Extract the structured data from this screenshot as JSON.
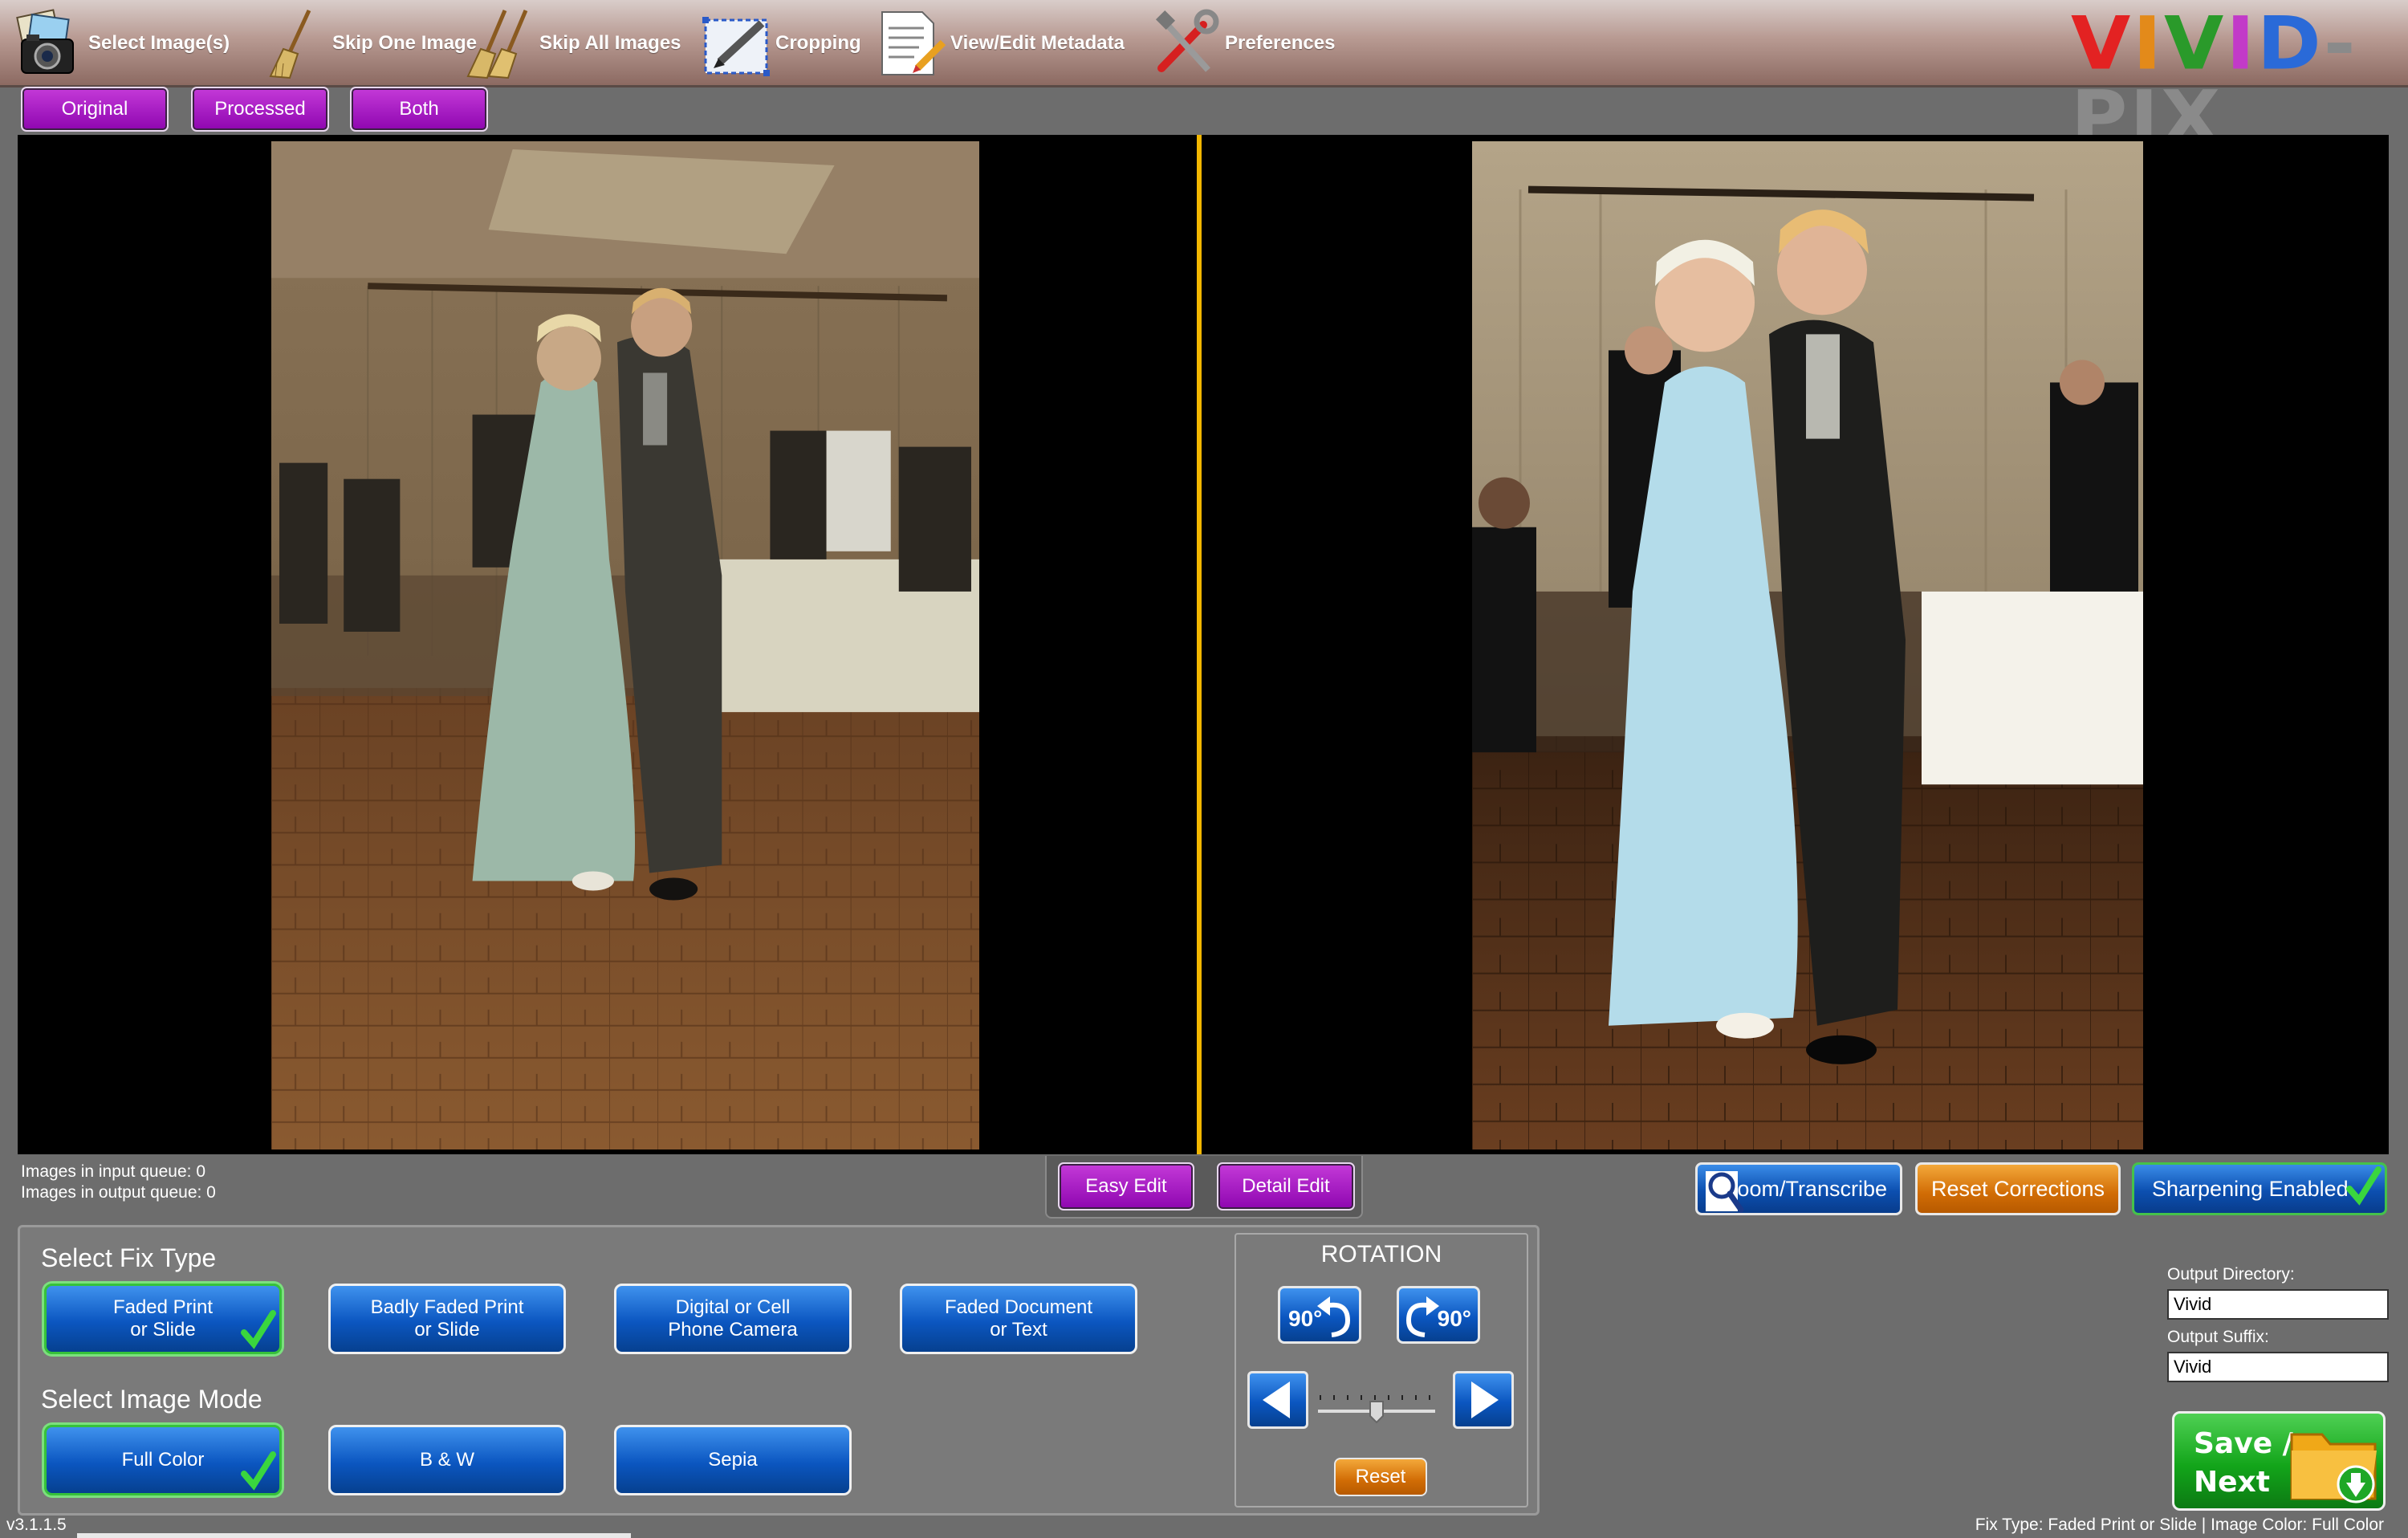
{
  "toolbar": {
    "items": [
      {
        "label": "Select Image(s)",
        "icon": "camera-photos-icon"
      },
      {
        "label": "Skip One Image",
        "icon": "broom-icon"
      },
      {
        "label": "Skip All Images",
        "icon": "brooms-icon"
      },
      {
        "label": "Cropping",
        "icon": "crop-pen-icon"
      },
      {
        "label": "View/Edit Metadata",
        "icon": "document-edit-icon"
      },
      {
        "label": "Preferences",
        "icon": "tools-icon"
      }
    ],
    "logo": "VIVID-PIX",
    "logo_colors": [
      "#e32222",
      "#e38a1a",
      "#2a9a2a",
      "#c23ac8",
      "#2a6ad8",
      "#8a8a8a",
      "#8a8a8a",
      "#8a8a8a",
      "#8a8a8a"
    ]
  },
  "view_toggle": {
    "original": "Original",
    "processed": "Processed",
    "both": "Both"
  },
  "queue": {
    "input": "Images in input queue:  0",
    "output": "Images in output queue: 0"
  },
  "edit_tabs": {
    "easy": "Easy Edit",
    "detail": "Detail Edit"
  },
  "actions": {
    "zoom": "Zoom/Transcribe",
    "reset_corrections": "Reset Corrections",
    "sharpening": "Sharpening Enabled"
  },
  "fix_type": {
    "title": "Select Fix Type",
    "options": [
      {
        "line1": "Faded Print",
        "line2": "or Slide",
        "selected": true
      },
      {
        "line1": "Badly Faded Print",
        "line2": "or Slide",
        "selected": false
      },
      {
        "line1": "Digital or Cell",
        "line2": "Phone Camera",
        "selected": false
      },
      {
        "line1": "Faded Document",
        "line2": "or Text",
        "selected": false
      }
    ]
  },
  "image_mode": {
    "title": "Select Image Mode",
    "options": [
      {
        "label": "Full Color",
        "selected": true
      },
      {
        "label": "B & W",
        "selected": false
      },
      {
        "label": "Sepia",
        "selected": false
      }
    ]
  },
  "rotation": {
    "title": "ROTATION",
    "ccw": "90°",
    "cw": "90°",
    "reset": "Reset",
    "slider_fraction": 0.5
  },
  "output": {
    "directory_label": "Output Directory:",
    "directory_value": "Vivid",
    "suffix_label": "Output Suffix:",
    "suffix_value": "Vivid"
  },
  "save": {
    "line1": "Save /",
    "line2": "Next"
  },
  "version": "v3.1.1.5",
  "status": "Fix Type:  Faded Print or Slide | Image Color: Full Color"
}
